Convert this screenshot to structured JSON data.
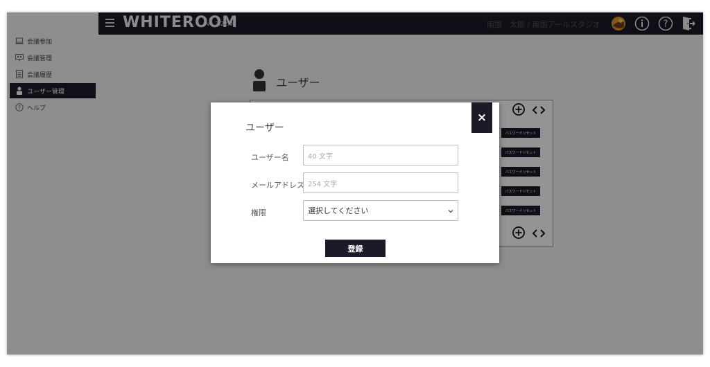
{
  "sidebar": {
    "items": [
      {
        "label": "会議参加",
        "icon": "laptop-icon",
        "active": false
      },
      {
        "label": "会議管理",
        "icon": "presentation-icon",
        "active": false
      },
      {
        "label": "会議履歴",
        "icon": "document-icon",
        "active": false
      },
      {
        "label": "ユーザー管理",
        "icon": "user-icon",
        "active": true
      },
      {
        "label": "ヘルプ",
        "icon": "help-circle-icon",
        "active": false
      }
    ]
  },
  "header": {
    "logo": "WHITEROOM",
    "version": "v1.2.22.0",
    "user": "南国　太郎 / 南国アールスタジオ",
    "icons": [
      "avatar-icon",
      "info-icon",
      "help-icon",
      "logout-icon"
    ]
  },
  "page": {
    "title": "ユーザー",
    "reset_label": "パスワードリセット"
  },
  "modal": {
    "title": "ユーザー",
    "close": "×",
    "fields": {
      "username_label": "ユーザー名",
      "username_placeholder": "40 文字",
      "email_label": "メールアドレス",
      "email_placeholder": "254 文字",
      "role_label": "権限",
      "role_value": "選択してください"
    },
    "submit": "登録"
  },
  "colors": {
    "dark": "#1b1a28",
    "sidebar_bg": "#f4f4f4"
  }
}
